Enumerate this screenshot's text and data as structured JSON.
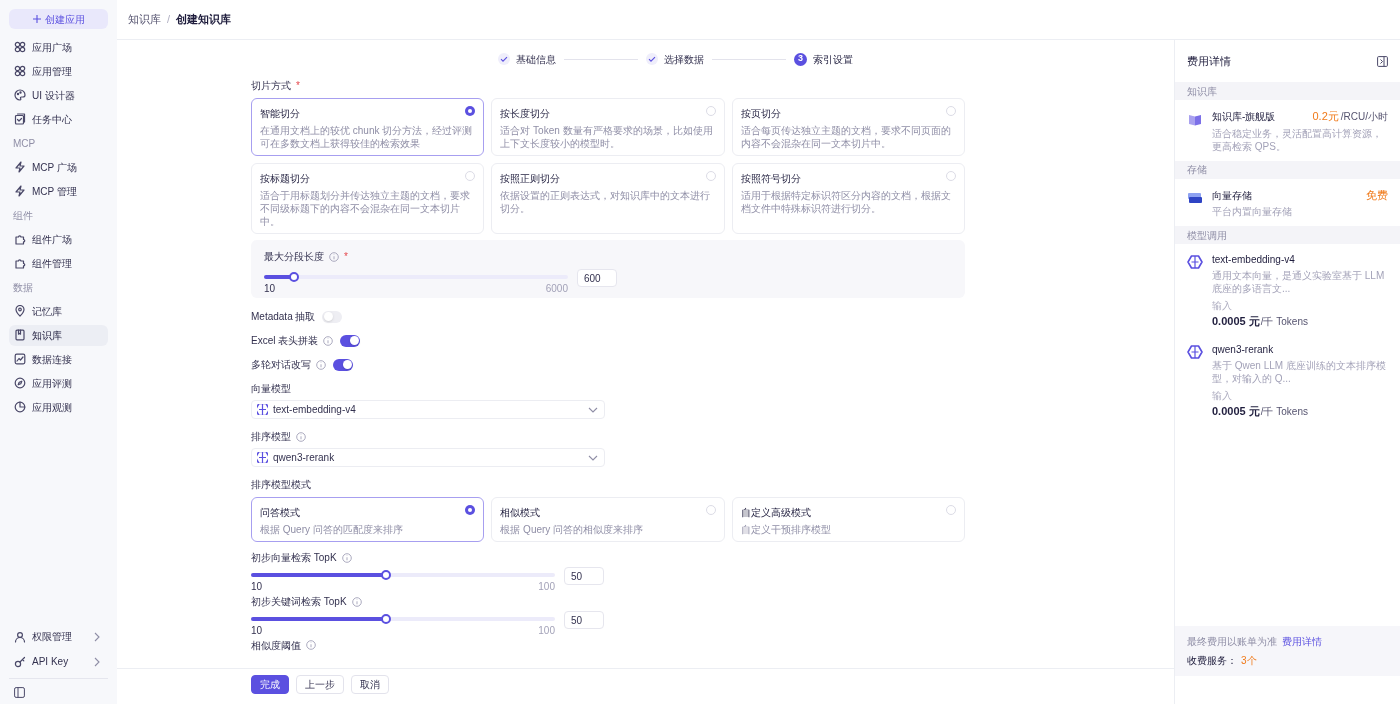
{
  "sidebar": {
    "create_button": "创建应用",
    "items": [
      {
        "kind": "item",
        "label": "应用广场",
        "selected": false
      },
      {
        "kind": "item",
        "label": "应用管理",
        "selected": false
      },
      {
        "kind": "item",
        "label": "UI 设计器",
        "selected": false
      },
      {
        "kind": "item",
        "label": "任务中心",
        "selected": false
      },
      {
        "kind": "section",
        "label": "MCP"
      },
      {
        "kind": "item",
        "label": "MCP 广场",
        "selected": false
      },
      {
        "kind": "item",
        "label": "MCP 管理",
        "selected": false
      },
      {
        "kind": "section",
        "label": "组件"
      },
      {
        "kind": "item",
        "label": "组件广场",
        "selected": false
      },
      {
        "kind": "item",
        "label": "组件管理",
        "selected": false
      },
      {
        "kind": "section",
        "label": "数据"
      },
      {
        "kind": "item",
        "label": "记忆库",
        "selected": false
      },
      {
        "kind": "item",
        "label": "知识库",
        "selected": true
      },
      {
        "kind": "item",
        "label": "数据连接",
        "selected": false
      },
      {
        "kind": "item",
        "label": "应用评测",
        "selected": false
      },
      {
        "kind": "item",
        "label": "应用观测",
        "selected": false
      }
    ],
    "bottom_items": [
      "权限管理",
      "API Key"
    ]
  },
  "breadcrumb": {
    "separator": "/",
    "items": [
      "知识库",
      "创建知识库"
    ]
  },
  "steps": [
    {
      "kind": "done",
      "label": "基础信息"
    },
    {
      "kind": "done",
      "label": "选择数据"
    },
    {
      "kind": "current",
      "number": "3",
      "label": "索引设置"
    }
  ],
  "chunking": {
    "label": "切片方式",
    "required_mark": "*",
    "options": [
      {
        "title": "智能切分",
        "desc": "在通用文档上的较优 chunk 切分方法，经过评测可在多数文档上获得较佳的检索效果",
        "selected": true
      },
      {
        "title": "按长度切分",
        "desc": "适合对 Token 数量有严格要求的场景，比如使用上下文长度较小的模型时。",
        "selected": false
      },
      {
        "title": "按页切分",
        "desc": "适合每页传达独立主题的文档，要求不同页面的内容不会混杂在同一文本切片中。",
        "selected": false
      },
      {
        "title": "按标题切分",
        "desc": "适合于用标题划分并传达独立主题的文档，要求不同级标题下的内容不会混杂在同一文本切片中。",
        "selected": false
      },
      {
        "title": "按照正则切分",
        "desc": "依据设置的正则表达式，对知识库中的文本进行切分。",
        "selected": false
      },
      {
        "title": "按照符号切分",
        "desc": "适用于根据特定标识符区分内容的文档，根据文档文件中特殊标识符进行切分。",
        "selected": false
      }
    ]
  },
  "max_length": {
    "label": "最大分段长度",
    "required_mark": "*",
    "level": 0.1,
    "min": "10",
    "max": "6000",
    "value": "600"
  },
  "toggles": [
    {
      "label": "Metadata 抽取",
      "info": false,
      "on": false
    },
    {
      "label": "Excel 表头拼装",
      "info": true,
      "on": true
    },
    {
      "label": "多轮对话改写",
      "info": true,
      "on": true
    }
  ],
  "selects": [
    {
      "label": "向量模型",
      "info": false,
      "value": "text-embedding-v4"
    },
    {
      "label": "排序模型",
      "info": true,
      "value": "qwen3-rerank"
    }
  ],
  "rank_mode": {
    "label": "排序模型模式",
    "options": [
      {
        "title": "问答模式",
        "desc": "根据 Query 问答的匹配度来排序",
        "selected": true
      },
      {
        "title": "相似模式",
        "desc": "根据 Query 问答的相似度来排序",
        "selected": false
      },
      {
        "title": "自定义高级模式",
        "desc": "自定义干预排序模型",
        "selected": false
      }
    ]
  },
  "sliders": [
    {
      "label": "初步向量检索 TopK",
      "level": 0.444,
      "min": "10",
      "max": "100",
      "value": "50"
    },
    {
      "label": "初步关键词检索 TopK",
      "level": 0.444,
      "min": "10",
      "max": "100",
      "value": "50"
    }
  ],
  "threshold_label": "相似度阈值",
  "footer_buttons": [
    {
      "kind": "primary",
      "label": "完成"
    },
    {
      "kind": "default",
      "label": "上一步"
    },
    {
      "kind": "default",
      "label": "取消"
    }
  ],
  "cost_panel": {
    "title": "费用详情",
    "sections": [
      {
        "label": "知识库",
        "items": [
          {
            "name": "知识库-旗舰版",
            "desc": "适合稳定业务，灵活配置高计算资源，更高检索 QPS。",
            "price": "0.2元",
            "unit": "/RCU/小时"
          }
        ]
      },
      {
        "label": "存储",
        "items": [
          {
            "name": "向量存储",
            "desc": "平台内置向量存储",
            "price": "免费"
          }
        ]
      },
      {
        "label": "模型调用",
        "items": [
          {
            "name": "text-embedding-v4",
            "desc": "通用文本向量，是通义实验室基于 LLM 底座的多语言文...",
            "input_label": "输入",
            "amount": "0.0005 元",
            "unit": "/千 Tokens"
          },
          {
            "name": "qwen3-rerank",
            "desc": "基于 Qwen LLM 底座训练的文本排序模型，对输入的 Q...",
            "input_label": "输入",
            "amount": "0.0005 元",
            "unit": "/千 Tokens"
          }
        ]
      }
    ],
    "note": "最终费用以账单为准",
    "note_link": "费用详情",
    "services_label": "收费服务：",
    "services_count": "3个"
  }
}
